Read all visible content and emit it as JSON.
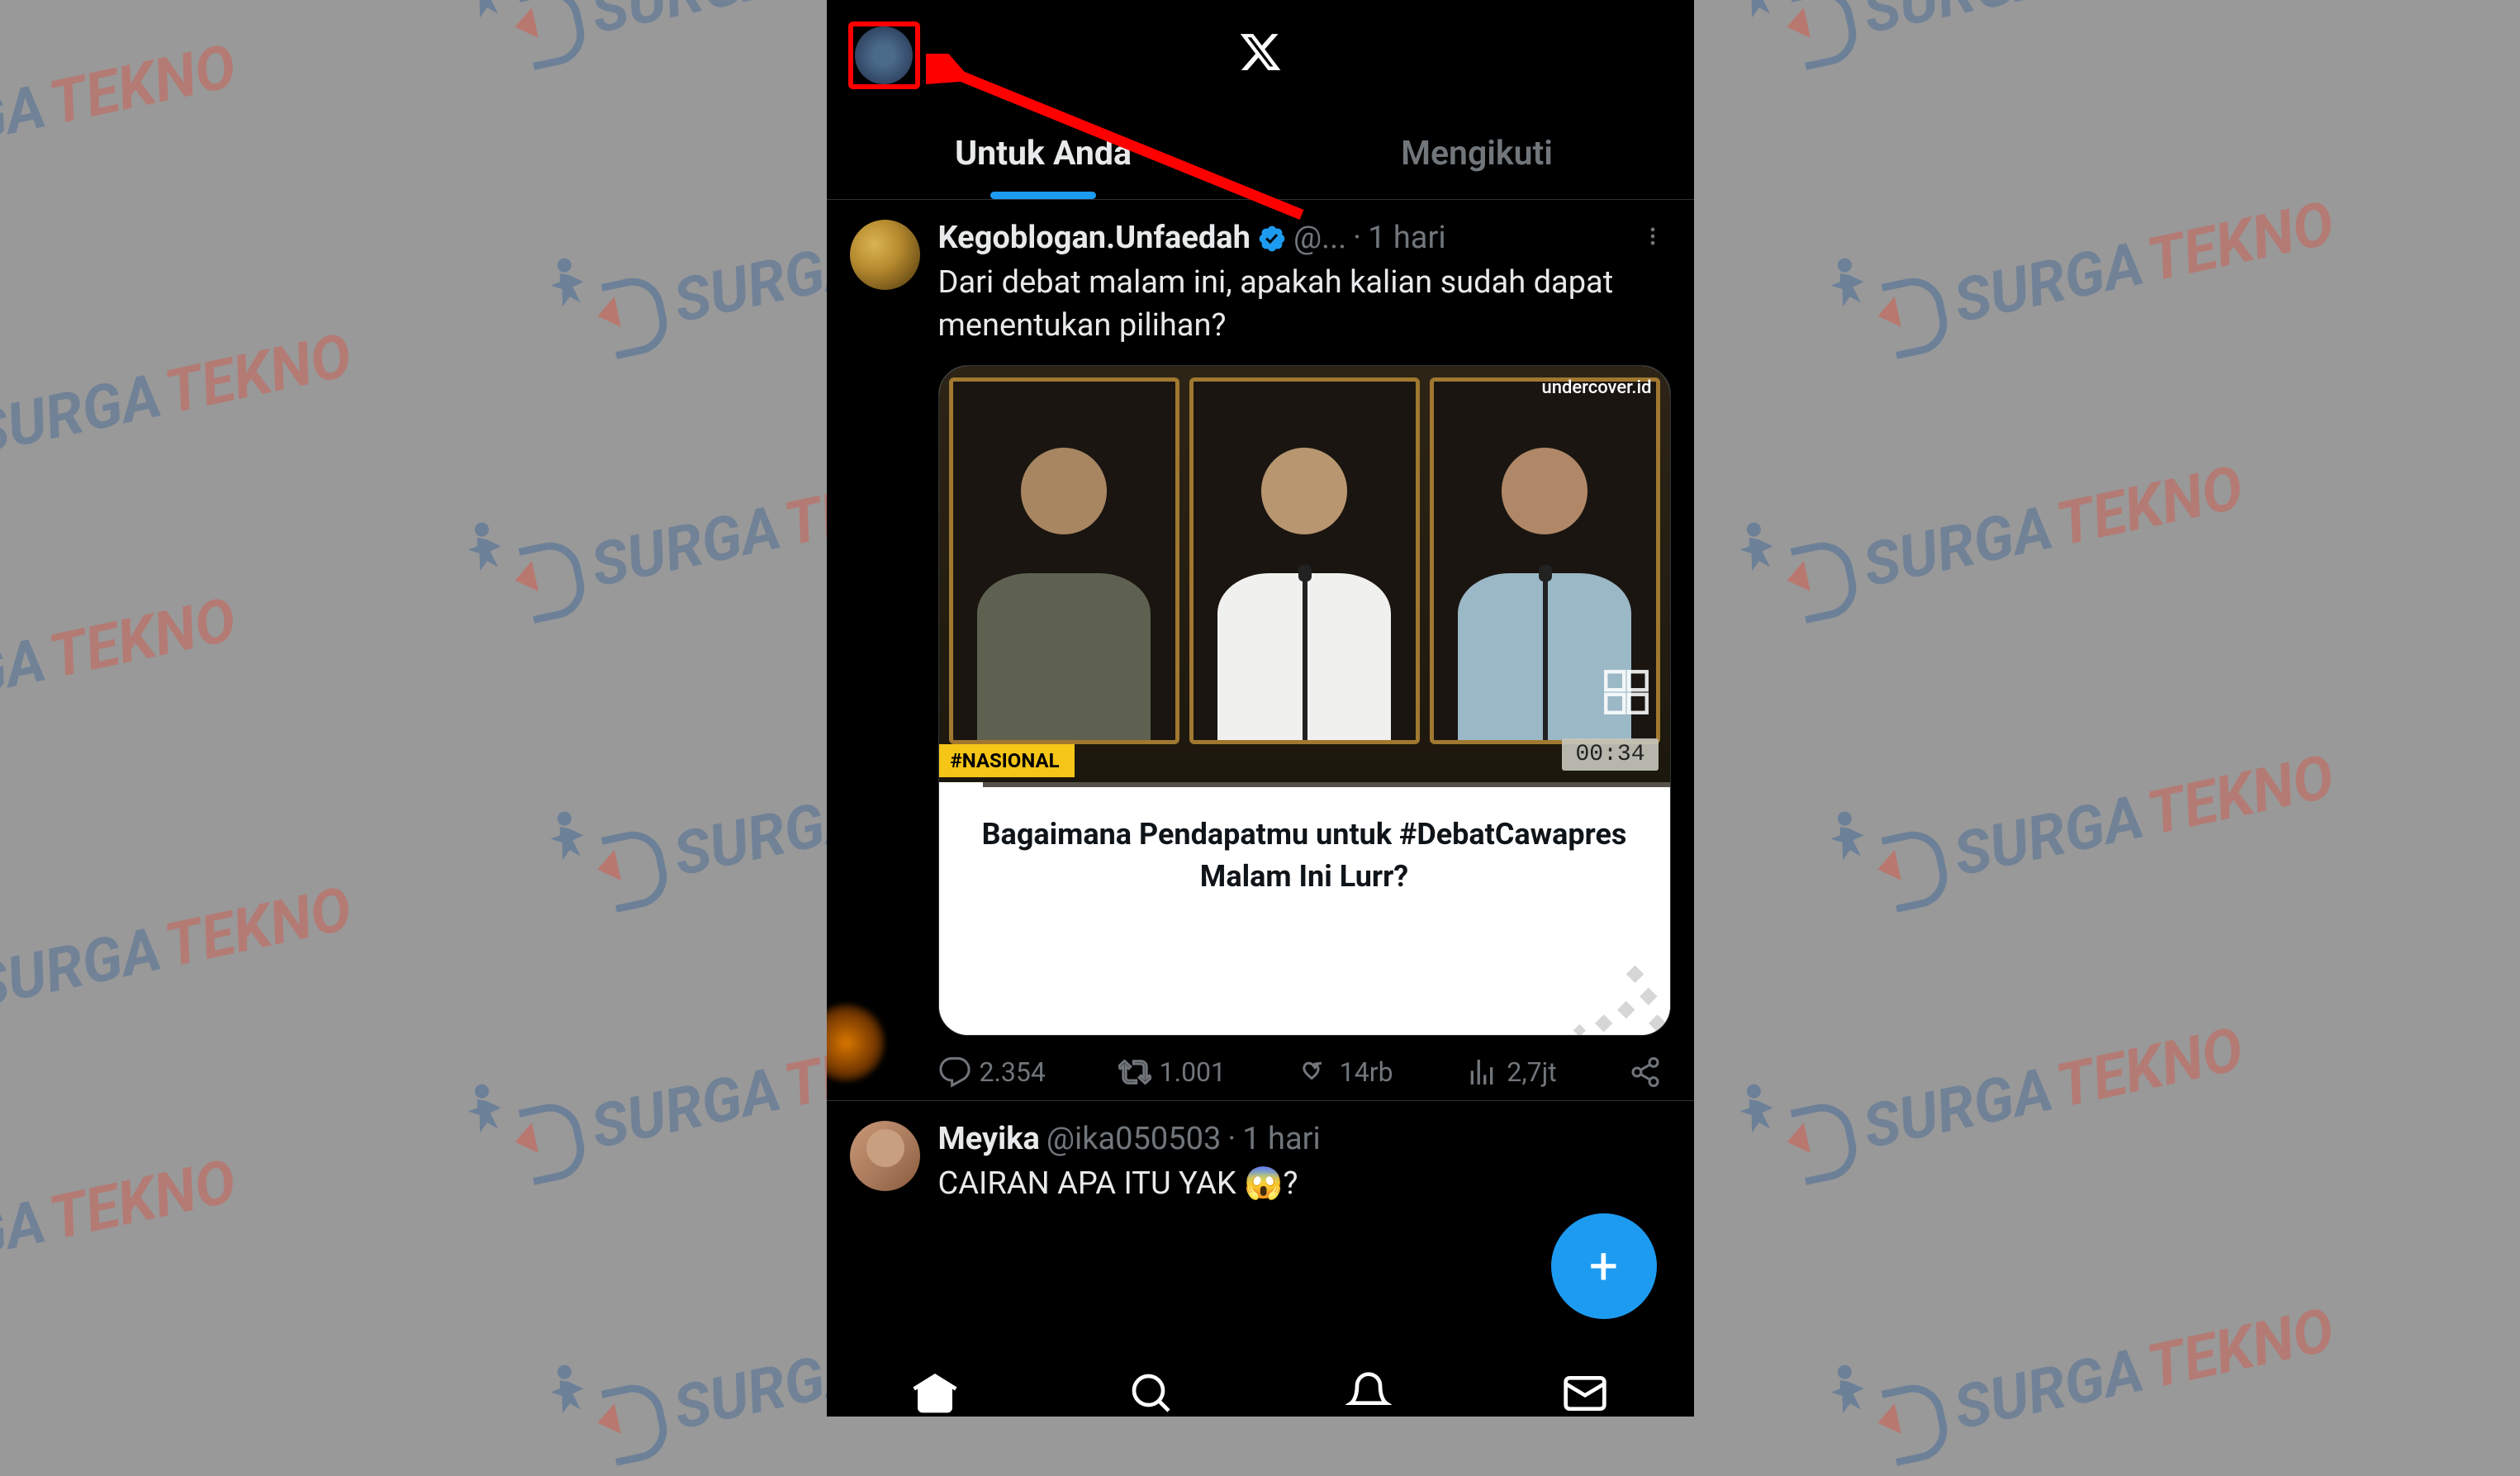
{
  "watermark": {
    "text_a": "SURGA",
    "text_b": "TEKNO"
  },
  "tabs": {
    "for_you": "Untuk Anda",
    "following": "Mengikuti"
  },
  "tweet1": {
    "name": "Kegoblogan.Unfaedah",
    "handle": "@...",
    "time": "1 hari",
    "text": "Dari debat malam ini, apakah kalian sudah dapat menentukan pilihan?",
    "media": {
      "source_tag": "undercover.id",
      "category_tag": "#NASIONAL",
      "timer": "00:34",
      "caption": "Bagaimana Pendapatmu untuk #DebatCawapres Malam Ini Lurr?"
    },
    "actions": {
      "replies": "2.354",
      "retweets": "1.001",
      "likes": "14rb",
      "views": "2,7jt"
    }
  },
  "tweet2": {
    "name": "Meyika",
    "handle": "@ika050503",
    "time": "1 hari",
    "text": "CAIRAN APA ITU YAK 😱?"
  },
  "icons": {
    "x_logo": "X",
    "plus": "+"
  }
}
